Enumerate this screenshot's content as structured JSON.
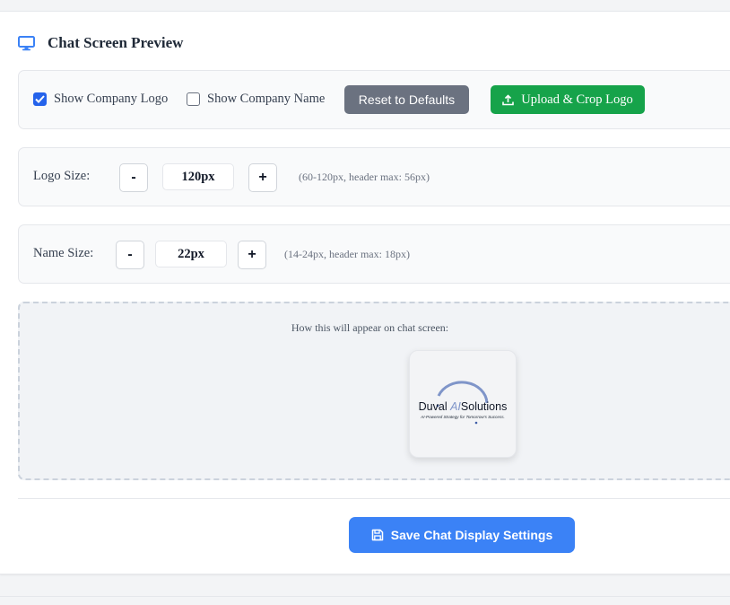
{
  "section": {
    "title": "Chat Screen Preview",
    "icon": "monitor-icon"
  },
  "toggles": {
    "show_logo": {
      "label": "Show Company Logo",
      "checked": true
    },
    "show_name": {
      "label": "Show Company Name",
      "checked": false
    }
  },
  "buttons": {
    "reset": "Reset to Defaults",
    "upload": "Upload & Crop Logo",
    "save": "Save Chat Display Settings"
  },
  "logo_size": {
    "label": "Logo Size:",
    "minus": "-",
    "plus": "+",
    "value": "120px",
    "hint": "(60-120px, header max: 56px)"
  },
  "name_size": {
    "label": "Name Size:",
    "minus": "-",
    "plus": "+",
    "value": "22px",
    "hint": "(14-24px, header max: 18px)"
  },
  "preview": {
    "caption": "How this will appear on chat screen:",
    "logo": {
      "brand_left": "Duval ",
      "brand_ai": "AI",
      "brand_right": "Solutions",
      "tagline": "AI-Powered Strategy for Tomorrow's Success."
    }
  },
  "colors": {
    "primary": "#3b82f6",
    "success": "#16a34a",
    "neutral": "#6b7280",
    "checkbox": "#2563eb"
  }
}
